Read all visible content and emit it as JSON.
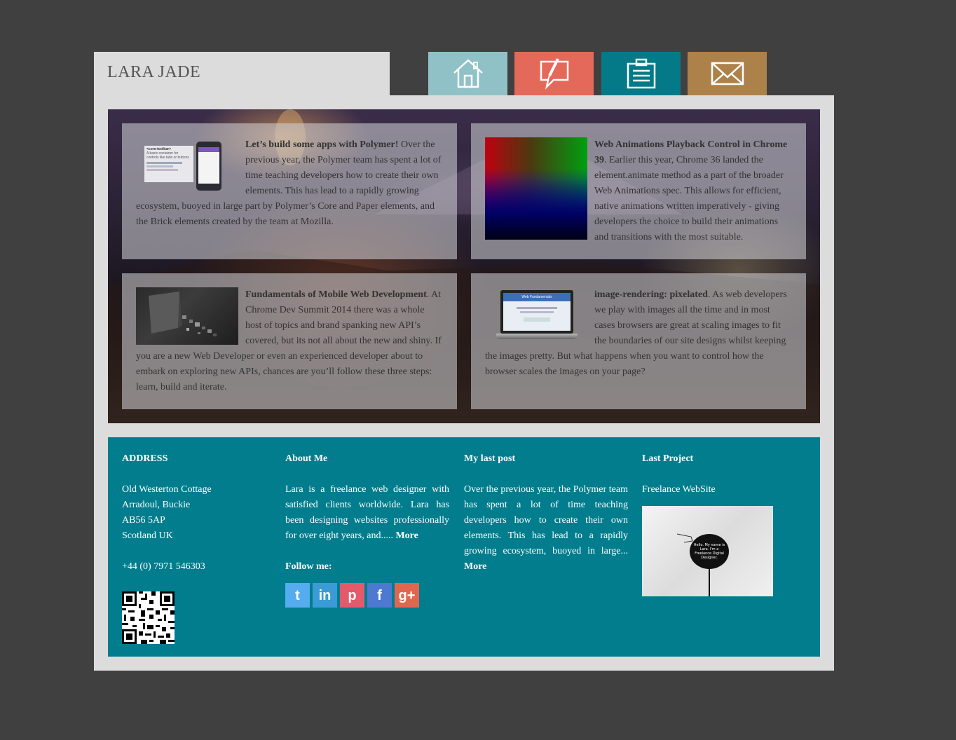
{
  "header": {
    "logo_text": "LARA JADE"
  },
  "nav": [
    {
      "name": "home",
      "icon": "home-icon",
      "color": "#8fc1c6"
    },
    {
      "name": "blog",
      "icon": "speech-pen-icon",
      "color": "#e4695a"
    },
    {
      "name": "portfolio",
      "icon": "clipboard-icon",
      "color": "#047a89"
    },
    {
      "name": "contact",
      "icon": "envelope-icon",
      "color": "#ad814a"
    }
  ],
  "posts": [
    {
      "title": "Let’s build some apps with Polymer!",
      "body": " Over the previous year, the Polymer team has spent a lot of time teaching developers how to create their own elements. This has lead to a rapidly growing ecosystem, buoyed in large part by Polymer’s Core and Paper elements, and the Brick elements created by the team at Mozilla.",
      "thumb_label": "<core-toolbar>",
      "thumb_caption": "A basic container for controls like tabs or buttons"
    },
    {
      "title": "Web Animations Playback Control in Chrome 39",
      "body": ". Earlier this year, Chrome 36 landed the element.animate method as a part of the broader Web Animations spec. This allows for efficient, native animations written imperatively - giving developers the choice to build their animations and transitions with the most suitable."
    },
    {
      "title": "Fundamentals of Mobile Web Development",
      "body": ". At Chrome Dev Summit 2014 there was a whole host of topics and brand spanking new API’s covered, but its not all about the new and shiny. If you are a new Web Developer or even an experienced developer about to embark on exploring new APIs, chances are you’ll follow these three steps: learn, build and iterate."
    },
    {
      "title": "image-rendering: pixelated",
      "body": ". As web developers we play with images all the time and in most cases browsers are great at scaling images to fit the boundaries of our site designs whilst keeping the images pretty. But what happens when you want to control how the browser scales the images on your page?",
      "thumb_label": "Web Fundamentals"
    }
  ],
  "footer": {
    "address": {
      "heading": "ADDRESS",
      "lines": [
        "Old Westerton Cottage",
        "Arradoul, Buckie",
        "AB56 5AP",
        "Scotland UK"
      ],
      "phone": "+44 (0) 7971 546303"
    },
    "about": {
      "heading": "About Me",
      "text": "Lara is a freelance web designer with satisfied clients worldwide. Lara has been designing websites professionally for over eight years, and..... ",
      "more": "More",
      "follow_heading": "Follow me:",
      "social": [
        {
          "name": "twitter",
          "glyph": "t",
          "color": "#55acee"
        },
        {
          "name": "linkedin",
          "glyph": "in",
          "color": "#3b9bd6"
        },
        {
          "name": "pinterest",
          "glyph": "p",
          "color": "#e55a6b"
        },
        {
          "name": "facebook",
          "glyph": "f",
          "color": "#4d79d0"
        },
        {
          "name": "google-plus",
          "glyph": "g+",
          "color": "#e2664f"
        }
      ]
    },
    "last_post": {
      "heading": "My last post",
      "text": "Over the previous year, the Polymer team has spent a lot of time teaching developers how to create their own elements. This has lead to a rapidly growing ecosystem, buoyed in large... ",
      "more": "More"
    },
    "last_project": {
      "heading": "Last Project",
      "title": "Freelance WebSite",
      "image_text": "Hello. My name is Lara. I'm a Freelance Digital Designer."
    }
  }
}
